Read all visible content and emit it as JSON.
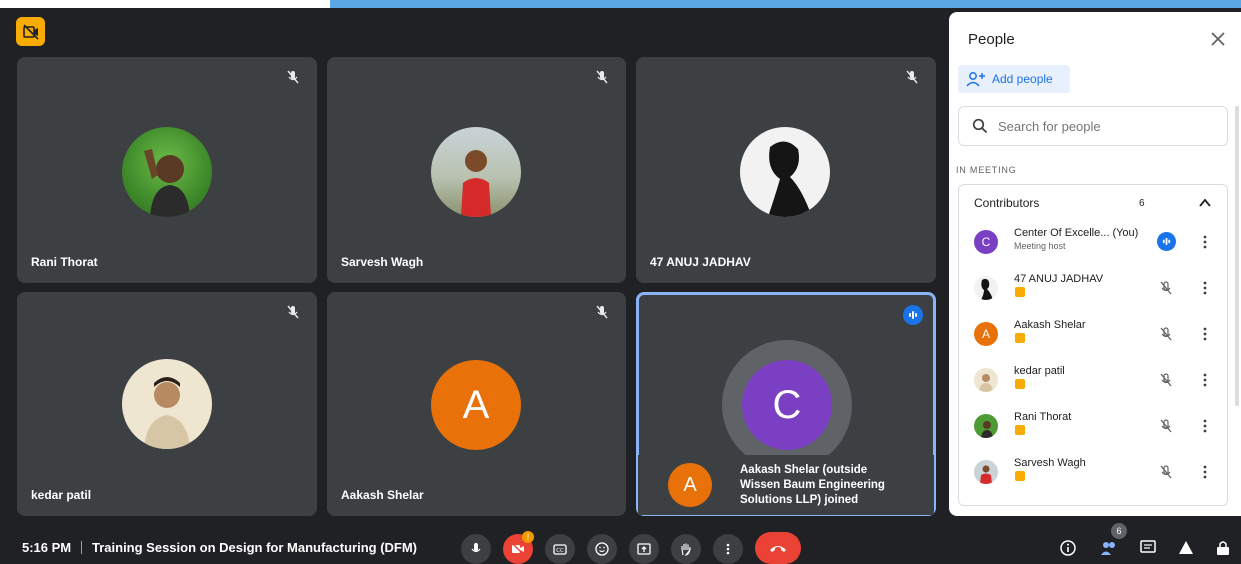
{
  "tiles": [
    {
      "name": "Rani Thorat"
    },
    {
      "name": "Sarvesh Wagh"
    },
    {
      "name": "47 ANUJ JADHAV"
    },
    {
      "name": "kedar patil"
    },
    {
      "name": "Aakash Shelar",
      "letter": "A",
      "color": "#e8710a"
    },
    {
      "letter": "C",
      "color": "#7b3fc4"
    }
  ],
  "toast": {
    "letter": "A",
    "text": "Aakash Shelar (outside Wissen Baum Engineering Solutions LLP) joined"
  },
  "bottom": {
    "time": "5:16 PM",
    "title": "Training Session on Design for Manufacturing (DFM)",
    "people_count": "6"
  },
  "panel": {
    "title": "People",
    "add_label": "Add people",
    "search_placeholder": "Search for people",
    "section": "IN MEETING",
    "group": "Contributors",
    "group_count": "6",
    "participants": [
      {
        "name": "Center Of Excelle...",
        "you": "(You)",
        "sub": "Meeting host",
        "letter": "C",
        "color": "#7b3fc4"
      },
      {
        "name": "47 ANUJ JADHAV"
      },
      {
        "name": "Aakash Shelar",
        "letter": "A",
        "color": "#e8710a"
      },
      {
        "name": "kedar patil"
      },
      {
        "name": "Rani Thorat"
      },
      {
        "name": "Sarvesh Wagh"
      }
    ]
  },
  "colors": {
    "accent": "#1a73e8",
    "end_call": "#ea4335",
    "badge": "#f9ab00"
  }
}
